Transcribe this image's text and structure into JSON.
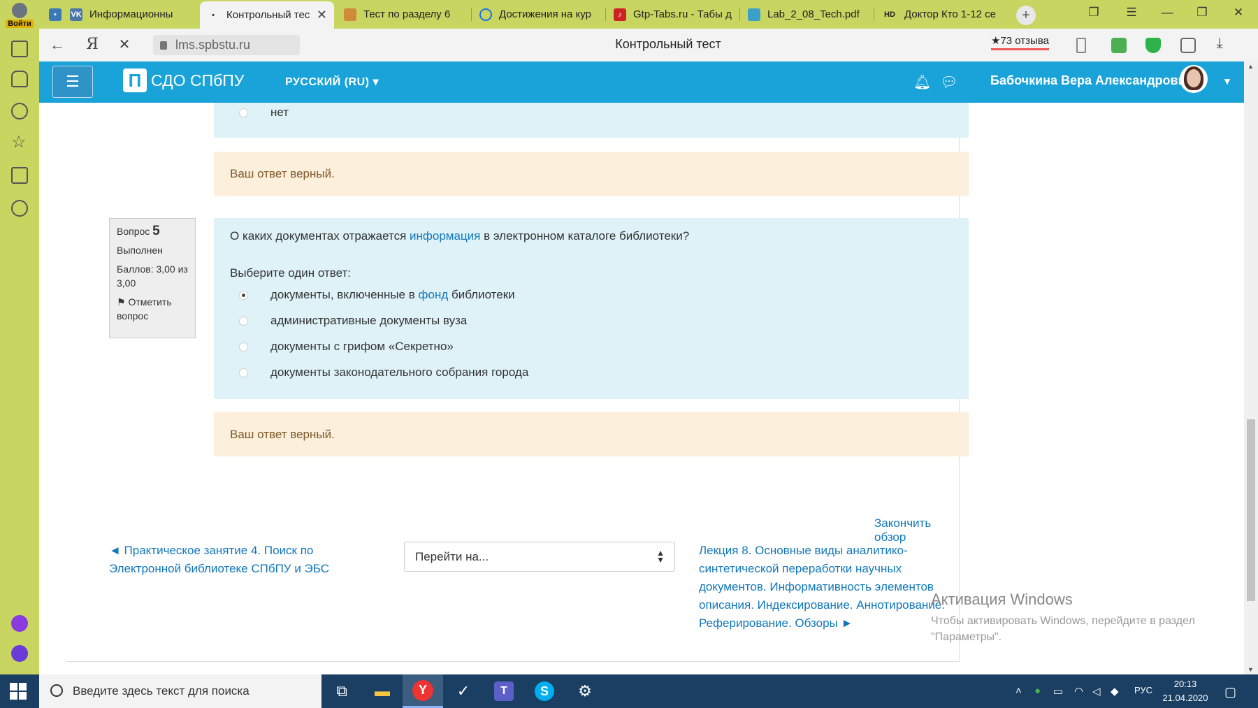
{
  "browser": {
    "profile_login": "Войти",
    "tabs": [
      {
        "label": "Информационные ",
        "icon": "vk-icon",
        "color": "#4a76a8"
      },
      {
        "label": "Контрольный тес",
        "icon": "loading-dot-icon",
        "color": "#333333"
      },
      {
        "label": "Тест по разделу 6",
        "icon": "tab-favicon-orange",
        "color": "#d08a3a"
      },
      {
        "label": "Достижения на кур",
        "icon": "spinner-icon",
        "color": "#1a73e8"
      },
      {
        "label": "Gtp-Tabs.ru - Табы д",
        "icon": "guitar-icon",
        "color": "#cc2222"
      },
      {
        "label": "Lab_2_08_Tech.pdf",
        "icon": "pdf-icon",
        "color": "#3aa0c8"
      },
      {
        "label": "Доктор Кто 1-12 се",
        "icon": "hd-icon",
        "color": "#222222"
      }
    ],
    "url": "lms.spbstu.ru",
    "page_title": "Контрольный тест",
    "reviews": "★73 отзыва"
  },
  "header": {
    "brand": "СДО СПбПУ",
    "brand_logo": "П",
    "language": "РУССКИЙ (RU)",
    "username": "Бабочкина Вера Александровна"
  },
  "question4": {
    "option_last": "нет",
    "feedback": "Ваш ответ верный."
  },
  "question5": {
    "label": "Вопрос",
    "number": "5",
    "status": "Выполнен",
    "score": "Баллов: 3,00 из 3,00",
    "flag": "Отметить вопрос",
    "text_before": "О каких документах отражается ",
    "text_link": "информация",
    "text_after": " в электронном каталоге библиотеки?",
    "prompt": "Выберите один ответ:",
    "options": [
      {
        "before": "документы, включенные в ",
        "link": "фонд",
        "after": " библиотеки",
        "selected": true
      },
      {
        "text": "административные документы вуза",
        "selected": false
      },
      {
        "text": "документы с грифом «Секретно»",
        "selected": false
      },
      {
        "text": "документы законодательного собрания города",
        "selected": false
      }
    ],
    "feedback": "Ваш ответ верный."
  },
  "navigation": {
    "finish_review": "Закончить обзор",
    "prev": "◄ Практическое занятие 4. Поиск по Электронной библиотеке СПбПУ и ЭБС",
    "jump_placeholder": "Перейти на...",
    "next": "Лекция 8. Основные виды аналитико-синтетической переработки научных документов. Информативность элементов описания. Индексирование. Аннотирование. Реферирование. Обзоры ►"
  },
  "watermark": {
    "title": "Активация Windows",
    "subtitle": "Чтобы активировать Windows, перейдите в раздел \"Параметры\"."
  },
  "taskbar": {
    "search_placeholder": "Введите здесь текст для поиска",
    "language": "РУС",
    "time": "20:13",
    "date": "21.04.2020"
  },
  "colors": {
    "header": "#1aa3d9",
    "browser_chrome": "#c8d560",
    "question_bg": "#def2f8",
    "feedback_bg": "#fcefdc",
    "link": "#1177bb",
    "taskbar": "#1a3f63"
  }
}
